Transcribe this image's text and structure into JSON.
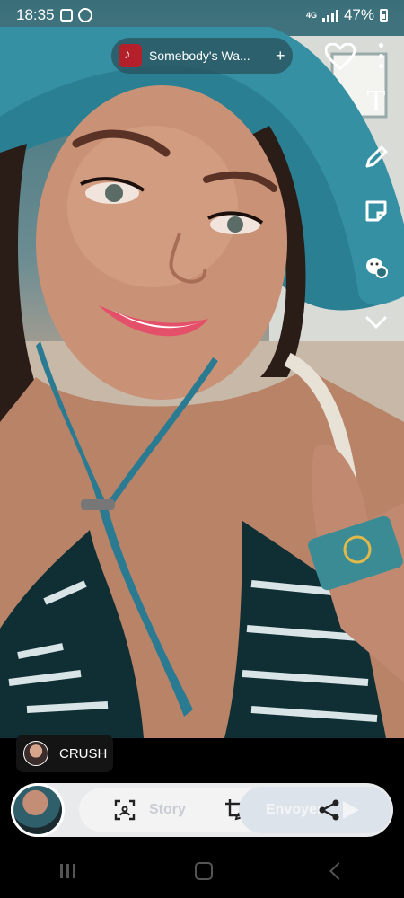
{
  "status_bar": {
    "time": "18:35",
    "network": "4G",
    "battery": "47%"
  },
  "music": {
    "title": "Somebody's Wa...",
    "add_symbol": "+"
  },
  "tools": {
    "text": "T",
    "items": [
      "text-tool-icon",
      "pencil-icon",
      "sticker-icon",
      "lens-icon",
      "chevron-down-icon",
      "heart-icon",
      "more-icon"
    ]
  },
  "recipient": {
    "label": "CRUSH"
  },
  "bottom_bar": {
    "story_label": "Story",
    "send_label": "Envoyer"
  }
}
